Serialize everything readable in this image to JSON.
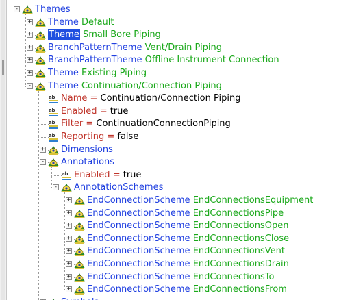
{
  "tree": {
    "nodes": [
      {
        "key": "Themes",
        "value": "",
        "op": "",
        "expander": "−",
        "icon": "object"
      },
      {
        "key": "Theme",
        "value": "Default",
        "op": "",
        "expander": "+",
        "icon": "object"
      },
      {
        "key": "Theme",
        "value": "Small Bore Piping",
        "op": "",
        "expander": "+",
        "icon": "object",
        "selected": true
      },
      {
        "key": "BranchPatternTheme",
        "value": "Vent/Drain Piping",
        "op": "",
        "expander": "+",
        "icon": "object"
      },
      {
        "key": "BranchPatternTheme",
        "value": "Offline Instrument Connection",
        "op": "",
        "expander": "+",
        "icon": "object"
      },
      {
        "key": "Theme",
        "value": "Existing Piping",
        "op": "",
        "expander": "+",
        "icon": "object"
      },
      {
        "key": "Theme",
        "value": "Continuation/Connection Piping",
        "op": "",
        "expander": "−",
        "icon": "object"
      },
      {
        "key": "Name",
        "value": "Continuation/Connection Piping",
        "op": "=",
        "expander": "",
        "icon": "property"
      },
      {
        "key": "Enabled",
        "value": "true",
        "op": "=",
        "expander": "",
        "icon": "property"
      },
      {
        "key": "Filter",
        "value": "ContinuationConnectionPiping",
        "op": "=",
        "expander": "",
        "icon": "property"
      },
      {
        "key": "Reporting",
        "value": "false",
        "op": "=",
        "expander": "",
        "icon": "property"
      },
      {
        "key": "Dimensions",
        "value": "",
        "op": "",
        "expander": "+",
        "icon": "object"
      },
      {
        "key": "Annotations",
        "value": "",
        "op": "",
        "expander": "−",
        "icon": "object"
      },
      {
        "key": "Enabled",
        "value": "true",
        "op": "=",
        "expander": "",
        "icon": "property"
      },
      {
        "key": "AnnotationSchemes",
        "value": "",
        "op": "",
        "expander": "−",
        "icon": "object"
      },
      {
        "key": "EndConnectionScheme",
        "value": "EndConnectionsEquipment",
        "op": "",
        "expander": "+",
        "icon": "object"
      },
      {
        "key": "EndConnectionScheme",
        "value": "EndConnectionsPipe",
        "op": "",
        "expander": "+",
        "icon": "object"
      },
      {
        "key": "EndConnectionScheme",
        "value": "EndConnectionsOpen",
        "op": "",
        "expander": "+",
        "icon": "object"
      },
      {
        "key": "EndConnectionScheme",
        "value": "EndConnectionsClose",
        "op": "",
        "expander": "+",
        "icon": "object"
      },
      {
        "key": "EndConnectionScheme",
        "value": "EndConnectionsVent",
        "op": "",
        "expander": "+",
        "icon": "object"
      },
      {
        "key": "EndConnectionScheme",
        "value": "EndConnectionsDrain",
        "op": "",
        "expander": "+",
        "icon": "object"
      },
      {
        "key": "EndConnectionScheme",
        "value": "EndConnectionsTo",
        "op": "",
        "expander": "+",
        "icon": "object"
      },
      {
        "key": "EndConnectionScheme",
        "value": "EndConnectionsFrom",
        "op": "",
        "expander": "+",
        "icon": "object"
      },
      {
        "key": "Symbols",
        "value": "",
        "op": "",
        "expander": "+",
        "icon": "object"
      }
    ]
  },
  "colors": {
    "object_key": "#1f3fe0",
    "object_value": "#1aa81a",
    "property_key": "#c0352b",
    "property_value": "#000000",
    "selection": "#1f4fe0"
  }
}
